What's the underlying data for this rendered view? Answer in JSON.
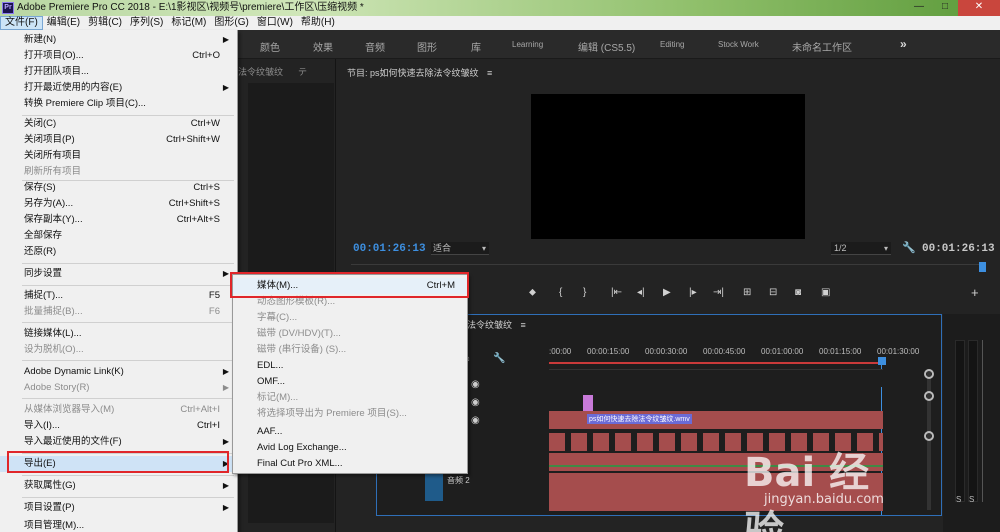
{
  "window": {
    "title": "Adobe Premiere Pro CC 2018 - E:\\1影视区\\视频号\\premiere\\工作区\\压缩视频 *",
    "app_icon": "Pr",
    "buttons": [
      "—",
      "□",
      "✕"
    ]
  },
  "menubar": [
    "文件(F)",
    "编辑(E)",
    "剪辑(C)",
    "序列(S)",
    "标记(M)",
    "图形(G)",
    "窗口(W)",
    "帮助(H)"
  ],
  "workspaces": [
    "颜色",
    "效果",
    "音频",
    "图形",
    "库",
    "Learning",
    "编辑 (CS5.5)",
    "Editing",
    "Stock Work",
    "未命名工作区",
    "»"
  ],
  "left_panel": {
    "title": "法令纹皱纹",
    "close": "テ"
  },
  "program_monitor": {
    "title": "节目: ps如何快速去除法令纹皱纹",
    "menu_icon": "≡",
    "timecode_left": "00:01:26:13",
    "fit": "适合",
    "resolution": "1/2",
    "timecode_right": "00:01:26:13"
  },
  "timeline": {
    "title": "法令纹皱纹",
    "menu_icon": "≡",
    "ticks": [
      ":00:00",
      "00:00:15:00",
      "00:00:30:00",
      "00:00:45:00",
      "00:01:00:00",
      "00:01:15:00",
      "00:01:30:00"
    ],
    "clip_label": "ps如何快速去除法令纹皱纹.wmv",
    "audio_track": "音频 2"
  },
  "audio_meter": {
    "labels": [
      "S",
      "S"
    ]
  },
  "file_menu": {
    "items": [
      {
        "label": "新建(N)",
        "shortcut": "",
        "submenu": true,
        "disabled": false
      },
      {
        "label": "打开项目(O)...",
        "shortcut": "Ctrl+O",
        "submenu": false,
        "disabled": false
      },
      {
        "label": "打开团队项目...",
        "shortcut": "",
        "submenu": false,
        "disabled": false
      },
      {
        "label": "打开最近使用的内容(E)",
        "shortcut": "",
        "submenu": true,
        "disabled": false
      },
      {
        "label": "转换 Premiere Clip 项目(C)...",
        "shortcut": "",
        "submenu": false,
        "disabled": false
      },
      {
        "label": "关闭(C)",
        "shortcut": "Ctrl+W",
        "submenu": false,
        "disabled": false
      },
      {
        "label": "关闭项目(P)",
        "shortcut": "Ctrl+Shift+W",
        "submenu": false,
        "disabled": false
      },
      {
        "label": "关闭所有项目",
        "shortcut": "",
        "submenu": false,
        "disabled": false
      },
      {
        "label": "刷新所有项目",
        "shortcut": "",
        "submenu": false,
        "disabled": true
      },
      {
        "label": "保存(S)",
        "shortcut": "Ctrl+S",
        "submenu": false,
        "disabled": false
      },
      {
        "label": "另存为(A)...",
        "shortcut": "Ctrl+Shift+S",
        "submenu": false,
        "disabled": false
      },
      {
        "label": "保存副本(Y)...",
        "shortcut": "Ctrl+Alt+S",
        "submenu": false,
        "disabled": false
      },
      {
        "label": "全部保存",
        "shortcut": "",
        "submenu": false,
        "disabled": false
      },
      {
        "label": "还原(R)",
        "shortcut": "",
        "submenu": false,
        "disabled": false
      },
      {
        "label": "同步设置",
        "shortcut": "",
        "submenu": true,
        "disabled": false
      },
      {
        "label": "捕捉(T)...",
        "shortcut": "F5",
        "submenu": false,
        "disabled": false
      },
      {
        "label": "批量捕捉(B)...",
        "shortcut": "F6",
        "submenu": false,
        "disabled": true
      },
      {
        "label": "链接媒体(L)...",
        "shortcut": "",
        "submenu": false,
        "disabled": false
      },
      {
        "label": "设为脱机(O)...",
        "shortcut": "",
        "submenu": false,
        "disabled": true
      },
      {
        "label": "Adobe Dynamic Link(K)",
        "shortcut": "",
        "submenu": true,
        "disabled": false
      },
      {
        "label": "Adobe Story(R)",
        "shortcut": "",
        "submenu": true,
        "disabled": true
      },
      {
        "label": "从媒体浏览器导入(M)",
        "shortcut": "Ctrl+Alt+I",
        "submenu": false,
        "disabled": true
      },
      {
        "label": "导入(I)...",
        "shortcut": "Ctrl+I",
        "submenu": false,
        "disabled": false
      },
      {
        "label": "导入最近使用的文件(F)",
        "shortcut": "",
        "submenu": true,
        "disabled": false
      },
      {
        "label": "导出(E)",
        "shortcut": "",
        "submenu": true,
        "disabled": false
      },
      {
        "label": "获取属性(G)",
        "shortcut": "",
        "submenu": true,
        "disabled": false
      },
      {
        "label": "项目设置(P)",
        "shortcut": "",
        "submenu": true,
        "disabled": false
      },
      {
        "label": "项目管理(M)...",
        "shortcut": "",
        "submenu": false,
        "disabled": false
      }
    ]
  },
  "export_menu": {
    "items": [
      {
        "label": "媒体(M)...",
        "shortcut": "Ctrl+M",
        "disabled": false
      },
      {
        "label": "动态图形模板(R)...",
        "shortcut": "",
        "disabled": true
      },
      {
        "label": "字幕(C)...",
        "shortcut": "",
        "disabled": true
      },
      {
        "label": "磁带 (DV/HDV)(T)...",
        "shortcut": "",
        "disabled": true
      },
      {
        "label": "磁带 (串行设备) (S)...",
        "shortcut": "",
        "disabled": true
      },
      {
        "label": "EDL...",
        "shortcut": "",
        "disabled": false
      },
      {
        "label": "OMF...",
        "shortcut": "",
        "disabled": false
      },
      {
        "label": "标记(M)...",
        "shortcut": "",
        "disabled": true
      },
      {
        "label": "将选择项导出为 Premiere 项目(S)...",
        "shortcut": "",
        "disabled": true
      },
      {
        "label": "AAF...",
        "shortcut": "",
        "disabled": false
      },
      {
        "label": "Avid Log Exchange...",
        "shortcut": "",
        "disabled": false
      },
      {
        "label": "Final Cut Pro XML...",
        "shortcut": "",
        "disabled": false
      }
    ]
  },
  "watermark": {
    "logo": "Bai 经验",
    "url": "jingyan.baidu.com"
  },
  "colors": {
    "highlight_box": "#e0262a",
    "timecode_blue": "#3d8fe0",
    "clip_red": "#a54d4d",
    "clip_purple": "#c87ad9"
  }
}
